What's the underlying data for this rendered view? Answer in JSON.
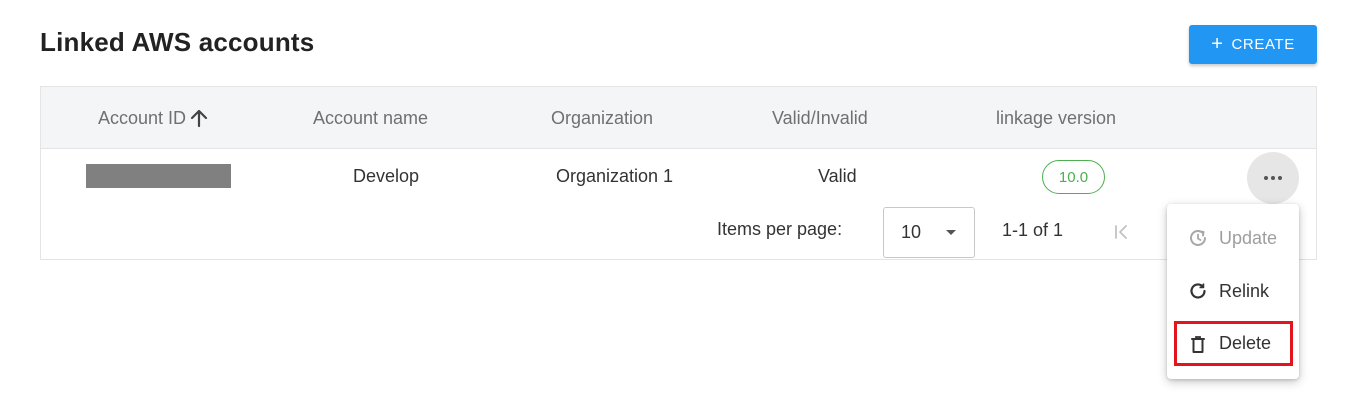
{
  "header": {
    "title": "Linked AWS accounts",
    "create_label": "CREATE",
    "create_icon": "plus-icon"
  },
  "table": {
    "columns": [
      "Account ID",
      "Account name",
      "Organization",
      "Valid/Invalid",
      "linkage version"
    ],
    "sort": {
      "column": "Account ID",
      "direction": "ascending",
      "icon": "arrow-up-icon"
    },
    "rows": [
      {
        "account_id_masked": true,
        "account_name": "Develop",
        "organization": "Organization 1",
        "status": "Valid",
        "linkage_version": "10.0",
        "actions_icon": "more-horizontal-icon"
      }
    ]
  },
  "pagination": {
    "items_per_page_label": "Items per page:",
    "items_per_page_value": "10",
    "range_text": "1-1 of 1",
    "first_page_icon": "first-page-icon"
  },
  "context_menu": {
    "items": [
      {
        "label": "Update",
        "icon": "update-icon",
        "disabled": true
      },
      {
        "label": "Relink",
        "icon": "refresh-icon",
        "disabled": false
      },
      {
        "label": "Delete",
        "icon": "trash-icon",
        "disabled": false,
        "highlighted": true
      }
    ]
  },
  "colors": {
    "primary": "#2196f3",
    "valid_green": "#4caf50",
    "highlight_red": "#e3141e",
    "header_bg": "#f4f5f7"
  }
}
